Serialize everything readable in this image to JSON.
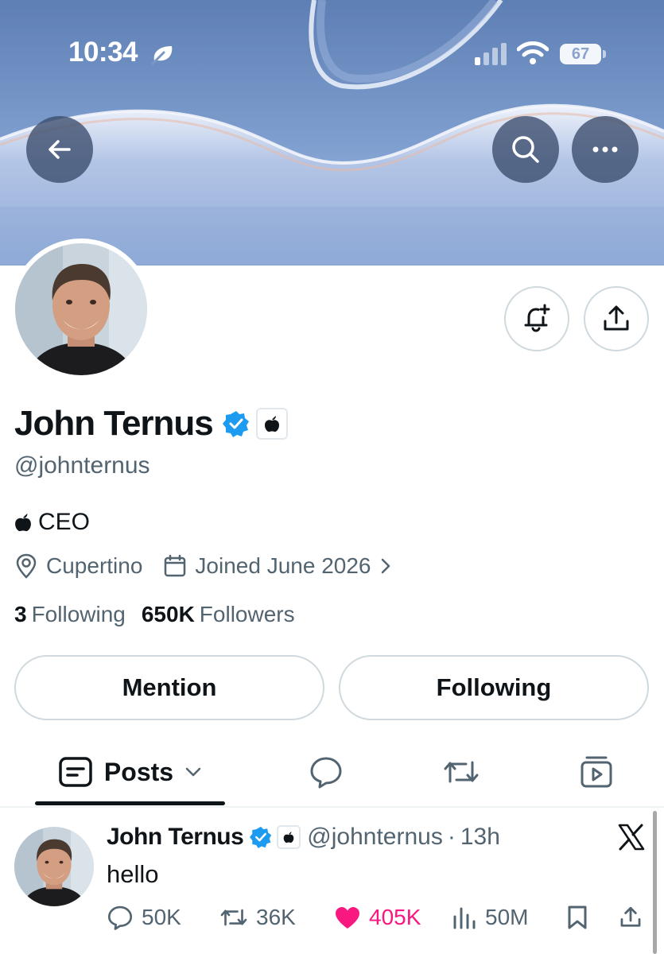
{
  "status_bar": {
    "time": "10:34",
    "battery": "67"
  },
  "header": {
    "back_icon": "arrow-left-icon",
    "search_icon": "search-icon",
    "more_icon": "more-horizontal-icon"
  },
  "profile": {
    "name": "John Ternus",
    "handle": "@johnternus",
    "bio": "CEO",
    "location": "Cupertino",
    "joined": "Joined June 2026",
    "following_count": "3",
    "following_label": "Following",
    "followers_count": "650K",
    "followers_label": "Followers",
    "verified_color": "#1d9bf0"
  },
  "buttons": {
    "mention": "Mention",
    "following": "Following"
  },
  "tabs": {
    "posts": "Posts",
    "items": [
      "posts",
      "replies",
      "reposts",
      "media"
    ]
  },
  "post": {
    "author": "John Ternus",
    "handle": "@johnternus",
    "separator": "·",
    "time": "13h",
    "text": "hello",
    "replies": "50K",
    "reposts": "36K",
    "likes": "405K",
    "views": "50M",
    "like_color": "#f91880"
  }
}
